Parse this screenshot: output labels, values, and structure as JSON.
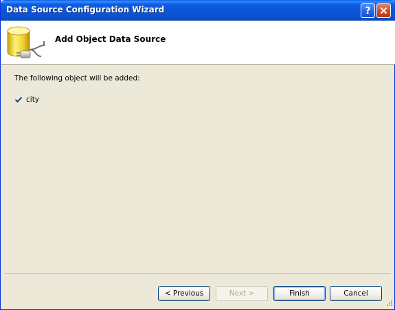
{
  "window": {
    "title": "Data Source Configuration Wizard"
  },
  "header": {
    "title": "Add Object Data Source",
    "icon": "database-plug-icon"
  },
  "content": {
    "intro": "The following object will be added:",
    "objects": [
      {
        "label": "city",
        "icon": "checkmark-icon"
      }
    ]
  },
  "buttons": {
    "previous": "< Previous",
    "next": "Next >",
    "finish": "Finish",
    "cancel": "Cancel"
  },
  "titlebar_buttons": {
    "help": "?",
    "close": "close-icon"
  },
  "colors": {
    "titlebar": "#0A55DA",
    "dialog_bg": "#ECE9D8",
    "header_bg": "#FFFFFF",
    "check": "#1F3E8C",
    "close": "#D0481E"
  }
}
